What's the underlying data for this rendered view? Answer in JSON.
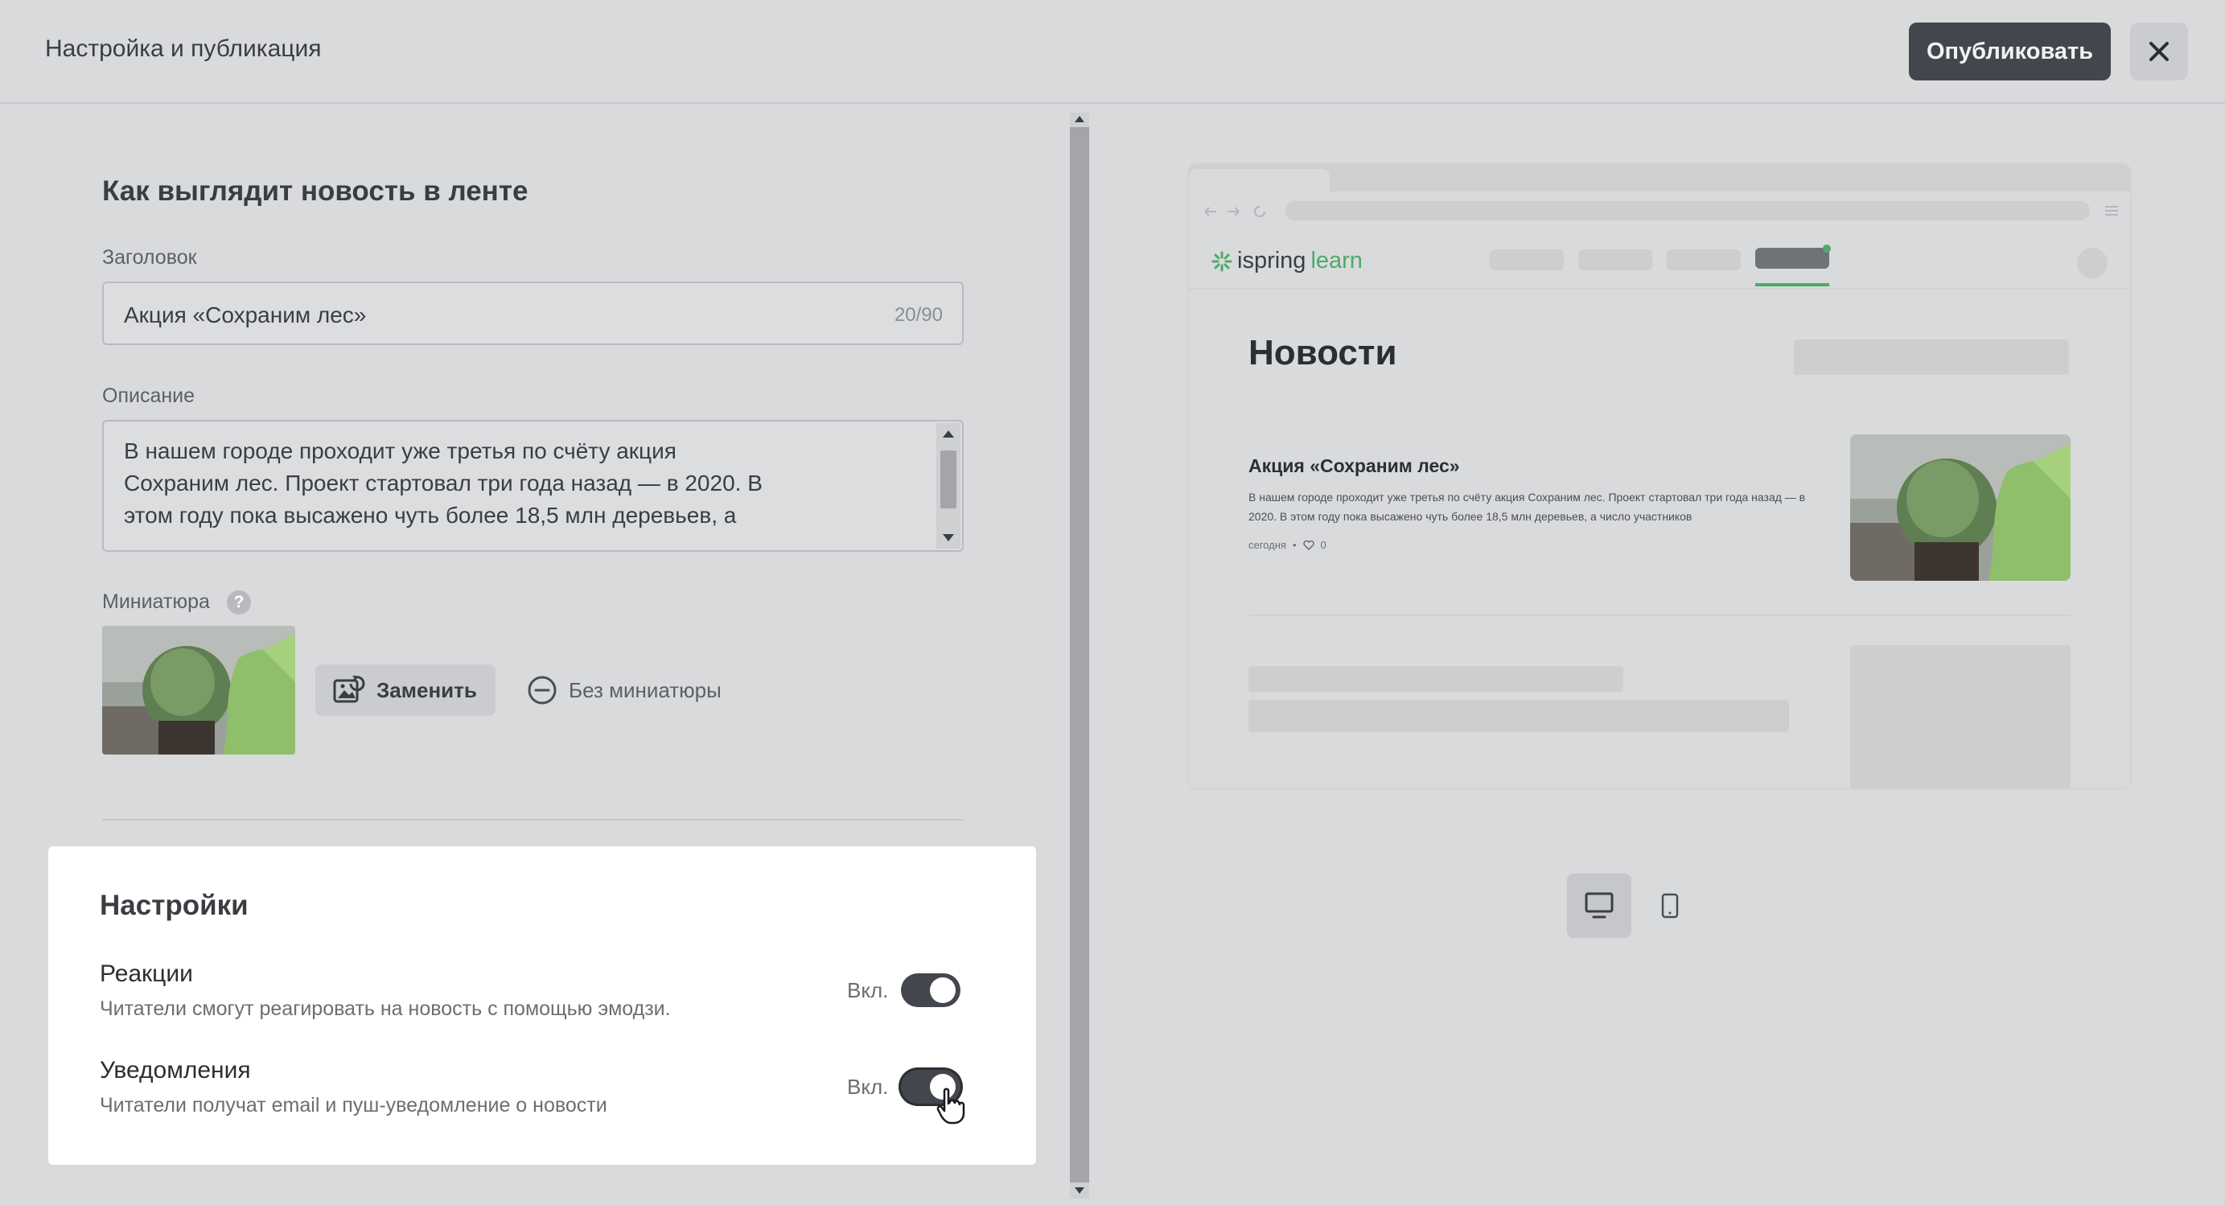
{
  "header": {
    "title": "Настройка и публикация",
    "publish_label": "Опубликовать"
  },
  "feed_section": {
    "title": "Как выглядит новость в ленте",
    "headline": {
      "label": "Заголовок",
      "value": "Акция «Сохраним лес»",
      "counter": "20/90"
    },
    "description": {
      "label": "Описание",
      "value": "В нашем городе проходит уже третья по счёту акция\nСохраним лес. Проект стартовал три года назад — в 2020. В\nэтом году пока высажено чуть более 18,5 млн деревьев, а"
    },
    "thumbnail": {
      "label": "Миниатюра",
      "replace_label": "Заменить",
      "remove_label": "Без миниатюры"
    }
  },
  "settings": {
    "title": "Настройки",
    "reactions": {
      "title": "Реакции",
      "description": "Читатели смогут реагировать на новость с помощью эмодзи.",
      "state_label": "Вкл."
    },
    "notifications": {
      "title": "Уведомления",
      "description": "Читатели получат email и пуш-уведомление о новости",
      "state_label": "Вкл."
    }
  },
  "preview": {
    "logo_part1": "ispring",
    "logo_part2": "learn",
    "page_title": "Новости",
    "item": {
      "title": "Акция «Сохраним лес»",
      "description": "В нашем городе проходит уже третья по счёту акция Сохраним лес. Проект стартовал три года назад — в 2020. В этом году пока высажено чуть более 18,5 млн деревьев, а число участников",
      "date": "сегодня",
      "likes": "0"
    }
  },
  "colors": {
    "accent_green": "#4fa96a",
    "toggle_on": "#43474d",
    "publish_bg": "#43474d"
  }
}
